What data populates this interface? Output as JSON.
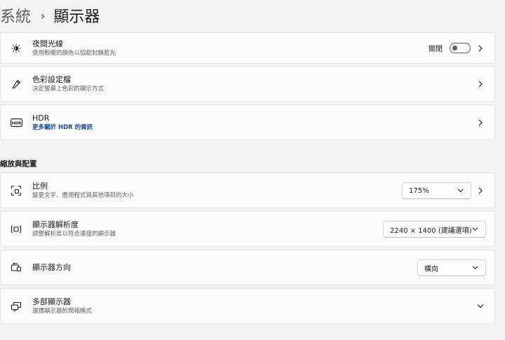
{
  "breadcrumb": {
    "parent": "系統",
    "separator": "›",
    "current": "顯示器"
  },
  "brightness": {
    "night_light": {
      "title": "夜間光線",
      "subtitle": "使用較暖的顏色以協助封鎖藍光",
      "toggle_label": "關閉",
      "toggle_on": false
    },
    "color_profile": {
      "title": "色彩設定檔",
      "subtitle": "決定螢幕上色彩的顯示方式"
    },
    "hdr": {
      "title": "HDR",
      "link": "更多關於 HDR 的資訊"
    }
  },
  "section_heading": "縮放與配置",
  "layout": {
    "scale": {
      "title": "比例",
      "subtitle": "變更文字、應用程式與其他項目的大小",
      "value": "175%"
    },
    "resolution": {
      "title": "顯示器解析度",
      "subtitle": "調整解析度以符合連接的顯示器",
      "value": "2240 × 1400 (建議選項)"
    },
    "orientation": {
      "title": "顯示器方向",
      "value": "橫向"
    },
    "multiple_displays": {
      "title": "多部顯示器",
      "subtitle": "選擇顯示器的簡報模式"
    }
  },
  "colors": {
    "background": "#f3f3f3",
    "card": "#fbfbfb",
    "link": "#1a4a8a"
  }
}
